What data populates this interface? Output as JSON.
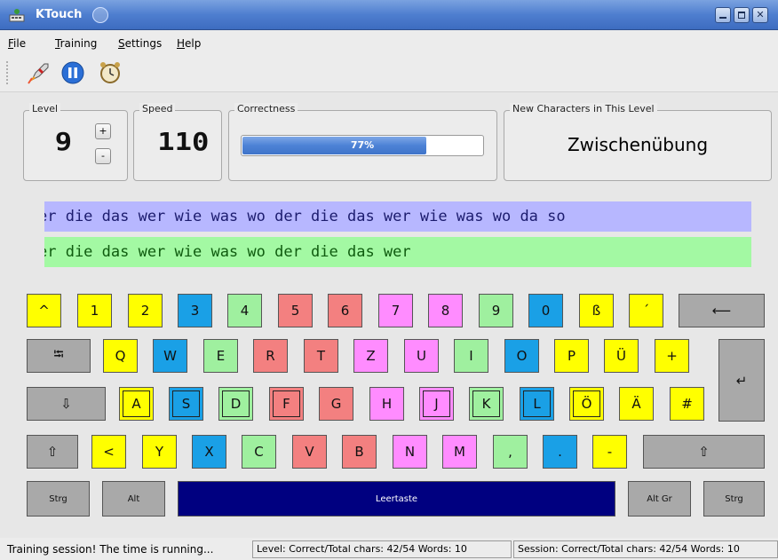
{
  "window": {
    "title": "KTouch"
  },
  "menu": {
    "items": [
      "File",
      "Training",
      "Settings",
      "Help"
    ]
  },
  "toolbar": {
    "icons": [
      "rocket-icon",
      "pause-icon",
      "alarm-clock-icon"
    ]
  },
  "panels": {
    "level": {
      "label": "Level",
      "value": "9",
      "plus": "+",
      "minus": "-"
    },
    "speed": {
      "label": "Speed",
      "value": "110"
    },
    "correctness": {
      "label": "Correctness",
      "percent_text": "77%",
      "percent_value": 77
    },
    "new_chars": {
      "label": "New Characters in This Level",
      "value": "Zwischenübung"
    }
  },
  "lines": {
    "teacher": "er die das wer wie was wo der die das wer wie was wo da so",
    "student": "er die das wer wie was wo der die das wer"
  },
  "keyboard": {
    "row1": [
      "^",
      "1",
      "2",
      "3",
      "4",
      "5",
      "6",
      "7",
      "8",
      "9",
      "0",
      "ß",
      "´",
      "⟵"
    ],
    "row2": [
      "⭾",
      "Q",
      "W",
      "E",
      "R",
      "T",
      "Z",
      "U",
      "I",
      "O",
      "P",
      "Ü",
      "+",
      "↵"
    ],
    "row3": [
      "⇩",
      "A",
      "S",
      "D",
      "F",
      "G",
      "H",
      "J",
      "K",
      "L",
      "Ö",
      "Ä",
      "#"
    ],
    "row4": [
      "⇧",
      "<",
      "Y",
      "X",
      "C",
      "V",
      "B",
      "N",
      "M",
      ",",
      ".",
      "-",
      "⇧"
    ],
    "row5": [
      "Strg",
      "Alt",
      "Leertaste",
      "Alt Gr",
      "Strg"
    ]
  },
  "status": {
    "message": "Training session! The time is running...",
    "level_stats": "Level:  Correct/Total chars: 42/54  Words: 10",
    "session_stats": "Session:  Correct/Total chars: 42/54  Words: 10"
  },
  "colors": {
    "teacher_line": "#b7b7ff",
    "student_line": "#a3f9a3",
    "progress": "#4d82d6",
    "space_key": "#000080"
  }
}
